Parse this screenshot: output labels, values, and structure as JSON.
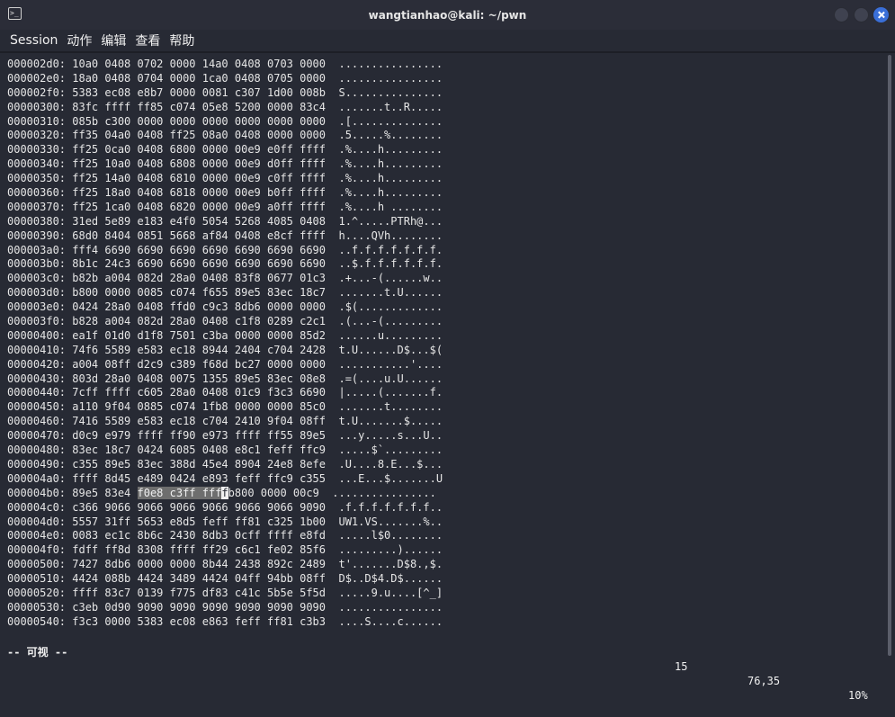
{
  "window": {
    "title": "wangtianhao@kali: ~/pwn",
    "app_icon_glyph": ">_"
  },
  "menu": [
    "Session",
    "动作",
    "编辑",
    "查看",
    "帮助"
  ],
  "hexdump": [
    {
      "addr": "000002d0:",
      "hex": "10a0 0408 0702 0000 14a0 0408 0703 0000",
      "ascii": "................"
    },
    {
      "addr": "000002e0:",
      "hex": "18a0 0408 0704 0000 1ca0 0408 0705 0000",
      "ascii": "................"
    },
    {
      "addr": "000002f0:",
      "hex": "5383 ec08 e8b7 0000 0081 c307 1d00 008b",
      "ascii": "S..............."
    },
    {
      "addr": "00000300:",
      "hex": "83fc ffff ff85 c074 05e8 5200 0000 83c4",
      "ascii": ".......t..R....."
    },
    {
      "addr": "00000310:",
      "hex": "085b c300 0000 0000 0000 0000 0000 0000",
      "ascii": ".[.............."
    },
    {
      "addr": "00000320:",
      "hex": "ff35 04a0 0408 ff25 08a0 0408 0000 0000",
      "ascii": ".5.....%........"
    },
    {
      "addr": "00000330:",
      "hex": "ff25 0ca0 0408 6800 0000 00e9 e0ff ffff",
      "ascii": ".%....h........."
    },
    {
      "addr": "00000340:",
      "hex": "ff25 10a0 0408 6808 0000 00e9 d0ff ffff",
      "ascii": ".%....h........."
    },
    {
      "addr": "00000350:",
      "hex": "ff25 14a0 0408 6810 0000 00e9 c0ff ffff",
      "ascii": ".%....h........."
    },
    {
      "addr": "00000360:",
      "hex": "ff25 18a0 0408 6818 0000 00e9 b0ff ffff",
      "ascii": ".%....h........."
    },
    {
      "addr": "00000370:",
      "hex": "ff25 1ca0 0408 6820 0000 00e9 a0ff ffff",
      "ascii": ".%....h ........"
    },
    {
      "addr": "00000380:",
      "hex": "31ed 5e89 e183 e4f0 5054 5268 4085 0408",
      "ascii": "1.^.....PTRh@..."
    },
    {
      "addr": "00000390:",
      "hex": "68d0 8404 0851 5668 af84 0408 e8cf ffff",
      "ascii": "h....QVh........"
    },
    {
      "addr": "000003a0:",
      "hex": "fff4 6690 6690 6690 6690 6690 6690 6690",
      "ascii": "..f.f.f.f.f.f.f."
    },
    {
      "addr": "000003b0:",
      "hex": "8b1c 24c3 6690 6690 6690 6690 6690 6690",
      "ascii": "..$.f.f.f.f.f.f."
    },
    {
      "addr": "000003c0:",
      "hex": "b82b a004 082d 28a0 0408 83f8 0677 01c3",
      "ascii": ".+...-(......w.."
    },
    {
      "addr": "000003d0:",
      "hex": "b800 0000 0085 c074 f655 89e5 83ec 18c7",
      "ascii": ".......t.U......"
    },
    {
      "addr": "000003e0:",
      "hex": "0424 28a0 0408 ffd0 c9c3 8db6 0000 0000",
      "ascii": ".$(............."
    },
    {
      "addr": "000003f0:",
      "hex": "b828 a004 082d 28a0 0408 c1f8 0289 c2c1",
      "ascii": ".(...-(........."
    },
    {
      "addr": "00000400:",
      "hex": "ea1f 01d0 d1f8 7501 c3ba 0000 0000 85d2",
      "ascii": "......u........."
    },
    {
      "addr": "00000410:",
      "hex": "74f6 5589 e583 ec18 8944 2404 c704 2428",
      "ascii": "t.U......D$...$("
    },
    {
      "addr": "00000420:",
      "hex": "a004 08ff d2c9 c389 f68d bc27 0000 0000",
      "ascii": "...........'...."
    },
    {
      "addr": "00000430:",
      "hex": "803d 28a0 0408 0075 1355 89e5 83ec 08e8",
      "ascii": ".=(....u.U......"
    },
    {
      "addr": "00000440:",
      "hex": "7cff ffff c605 28a0 0408 01c9 f3c3 6690",
      "ascii": "|.....(.......f."
    },
    {
      "addr": "00000450:",
      "hex": "a110 9f04 0885 c074 1fb8 0000 0000 85c0",
      "ascii": ".......t........"
    },
    {
      "addr": "00000460:",
      "hex": "7416 5589 e583 ec18 c704 2410 9f04 08ff",
      "ascii": "t.U.......$....."
    },
    {
      "addr": "00000470:",
      "hex": "d0c9 e979 ffff ff90 e973 ffff ff55 89e5",
      "ascii": "...y.....s...U.."
    },
    {
      "addr": "00000480:",
      "hex": "83ec 18c7 0424 6085 0408 e8c1 feff ffc9",
      "ascii": ".....$`........."
    },
    {
      "addr": "00000490:",
      "hex": "c355 89e5 83ec 388d 45e4 8904 24e8 8efe",
      "ascii": ".U....8.E...$..."
    },
    {
      "addr": "000004a0:",
      "hex": "ffff 8d45 e489 0424 e893 feff ffc9 c355",
      "ascii": "...E...$.......U"
    },
    {
      "addr": "000004b0:",
      "hex_pre": "89e5 83e4 ",
      "hex_sel": "f0e8 c3ff fff",
      "hex_cur": "f",
      "hex_post": "b800 0000 00c9",
      "ascii": "................"
    },
    {
      "addr": "000004c0:",
      "hex": "c366 9066 9066 9066 9066 9066 9066 9090",
      "ascii": ".f.f.f.f.f.f.f.."
    },
    {
      "addr": "000004d0:",
      "hex": "5557 31ff 5653 e8d5 feff ff81 c325 1b00",
      "ascii": "UW1.VS.......%.."
    },
    {
      "addr": "000004e0:",
      "hex": "0083 ec1c 8b6c 2430 8db3 0cff ffff e8fd",
      "ascii": ".....l$0........"
    },
    {
      "addr": "000004f0:",
      "hex": "fdff ff8d 8308 ffff ff29 c6c1 fe02 85f6",
      "ascii": ".........)......"
    },
    {
      "addr": "00000500:",
      "hex": "7427 8db6 0000 0000 8b44 2438 892c 2489",
      "ascii": "t'.......D$8.,$."
    },
    {
      "addr": "00000510:",
      "hex": "4424 088b 4424 3489 4424 04ff 94bb 08ff",
      "ascii": "D$..D$4.D$......"
    },
    {
      "addr": "00000520:",
      "hex": "ffff 83c7 0139 f775 df83 c41c 5b5e 5f5d",
      "ascii": ".....9.u....[^_]"
    },
    {
      "addr": "00000530:",
      "hex": "c3eb 0d90 9090 9090 9090 9090 9090 9090",
      "ascii": "................"
    },
    {
      "addr": "00000540:",
      "hex": "f3c3 0000 5383 ec08 e863 feff ff81 c3b3",
      "ascii": "....S....c......"
    }
  ],
  "status": {
    "mode": "-- 可视 --",
    "count": "15",
    "position": "76,35",
    "percent": "10%"
  }
}
